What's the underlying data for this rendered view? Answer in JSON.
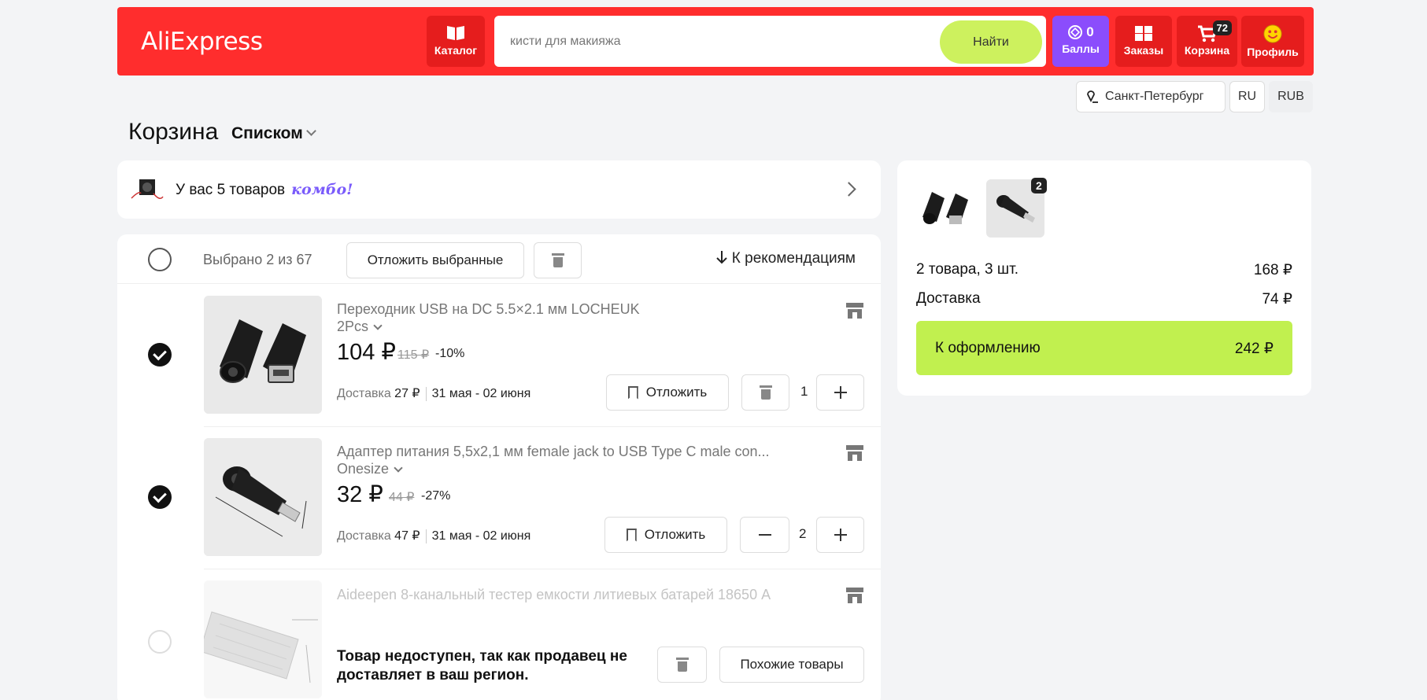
{
  "header": {
    "logo": "AliExpress",
    "catalog_label": "Каталог",
    "search_placeholder": "кисти для макияжа",
    "search_button": "Найти",
    "points_value": "0",
    "points_label": "Баллы",
    "orders_label": "Заказы",
    "cart_label": "Корзина",
    "cart_count": "72",
    "profile_label": "Профиль"
  },
  "locale": {
    "city": "Санкт-Петербург",
    "language": "RU",
    "currency": "RUB"
  },
  "page": {
    "title": "Корзина",
    "view_mode": "Списком"
  },
  "combo": {
    "text": "У вас 5 товаров",
    "tag": "комбо!"
  },
  "toolbar": {
    "selected_text": "Выбрано 2 из 67",
    "postpone_selected": "Отложить выбранные",
    "to_recommendations": "К рекомендациям"
  },
  "items": [
    {
      "name": "Переходник USB на DC 5.5×2.1 мм LOCHEUK",
      "variant": "2Pcs",
      "price": "104 ₽",
      "old_price": "115 ₽",
      "discount": "-10%",
      "delivery_label": "Доставка",
      "delivery_cost": "27 ₽",
      "delivery_dates": "31 мая - 02 июня",
      "postpone_label": "Отложить",
      "quantity": "1",
      "checked": true
    },
    {
      "name": "Адаптер питания 5,5x2,1 мм female jack to USB Type C male con...",
      "variant": "Onesize",
      "price": "32 ₽",
      "old_price": "44 ₽",
      "discount": "-27%",
      "delivery_label": "Доставка",
      "delivery_cost": "47 ₽",
      "delivery_dates": "31 мая - 02 июня",
      "postpone_label": "Отложить",
      "quantity": "2",
      "checked": true
    },
    {
      "name": "Aideepen 8-канальный тестер емкости литиевых батарей 18650 A",
      "unavailable_text": "Товар недоступен, так как продавец не доставляет в ваш регион.",
      "similar_label": "Похожие товары",
      "checked": false
    }
  ],
  "summary": {
    "thumb_badge": "2",
    "items_label": "2 товара, 3 шт.",
    "items_total": "168 ₽",
    "delivery_label": "Доставка",
    "delivery_total": "74 ₽",
    "checkout_label": "К оформлению",
    "checkout_total": "242 ₽"
  },
  "colors": {
    "header_red": "#ff2d2d",
    "accent_green": "#c1f04f",
    "points_purple": "#8b4dfc",
    "combo_purple": "#7a5bfb"
  }
}
